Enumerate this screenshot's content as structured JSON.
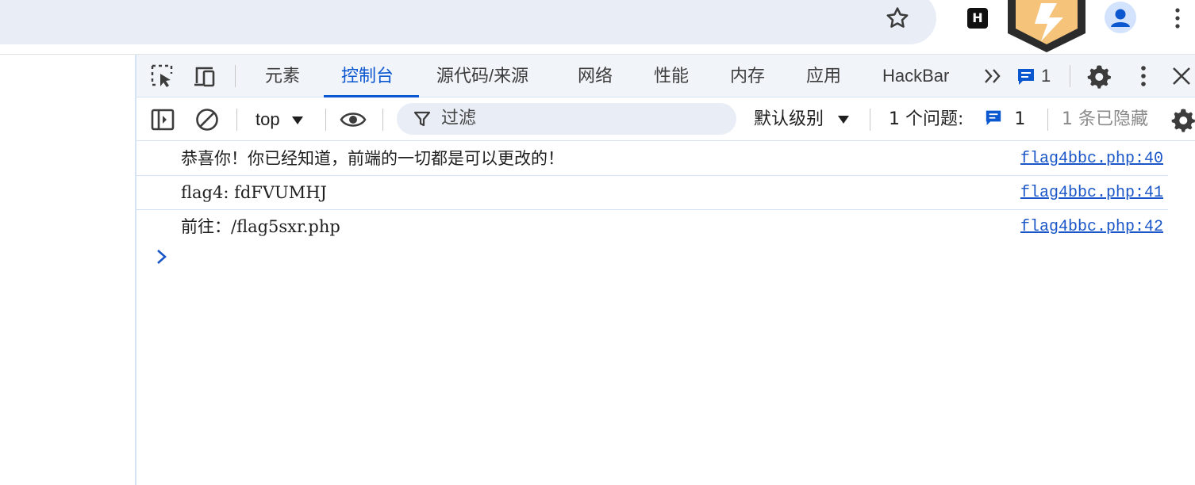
{
  "colors": {
    "accent": "#0b57d0",
    "omnibox_bg": "#e9eef6",
    "link": "#1a56c8",
    "border": "#d6e2f5"
  },
  "browser": {
    "extension_h_label": "H",
    "icons": [
      "star-icon",
      "ext-h-icon",
      "ext-badge-icon",
      "avatar",
      "chrome-menu-icon"
    ]
  },
  "devtools": {
    "tabs": [
      {
        "label": "元素",
        "active": false
      },
      {
        "label": "控制台",
        "active": true
      },
      {
        "label": "源代码/来源",
        "active": false
      },
      {
        "label": "网络",
        "active": false
      },
      {
        "label": "性能",
        "active": false
      },
      {
        "label": "内存",
        "active": false
      },
      {
        "label": "应用",
        "active": false
      },
      {
        "label": "HackBar",
        "active": false
      }
    ],
    "issues_badge_count": "1"
  },
  "console_toolbar": {
    "context": "top",
    "filter_placeholder": "过滤",
    "level": "默认级别",
    "issues_label": "1 个问题:",
    "issues_count": "1",
    "hidden_label": "1 条已隐藏"
  },
  "console": {
    "messages": [
      {
        "text": "恭喜你！你已经知道，前端的一切都是可以更改的！",
        "source": "flag4bbc.php:40"
      },
      {
        "text": "flag4: fdFVUMHJ",
        "source": "flag4bbc.php:41"
      },
      {
        "text": "前往：/flag5sxr.php",
        "source": "flag4bbc.php:42"
      }
    ]
  }
}
